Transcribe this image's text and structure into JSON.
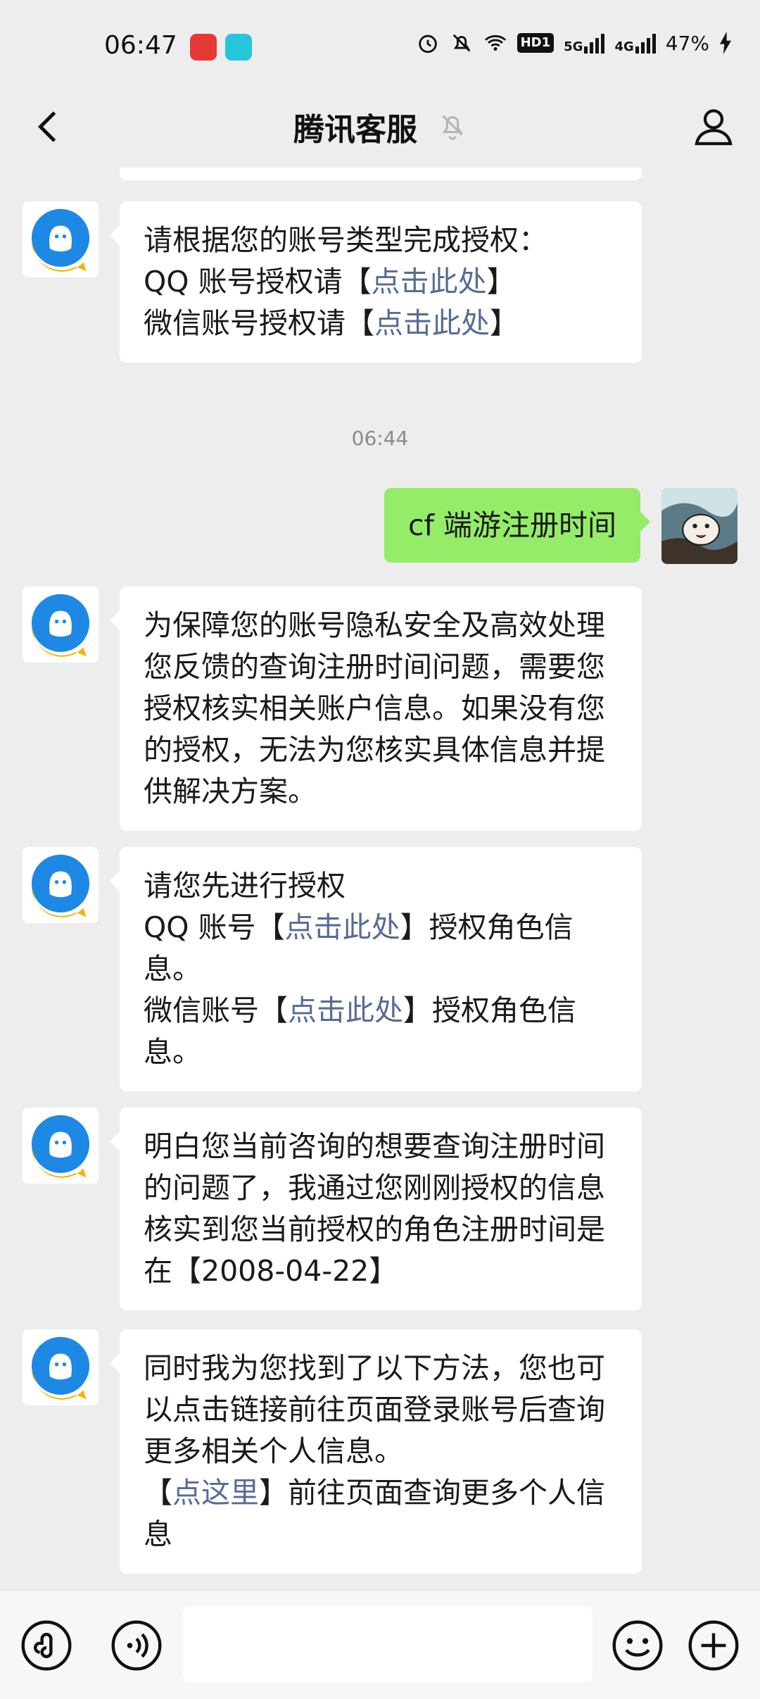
{
  "status_bar": {
    "time": "06:47",
    "network_1": "5G",
    "network_2": "4G",
    "hd_badge": "HD1",
    "battery": "47%"
  },
  "nav": {
    "title": "腾讯客服"
  },
  "messages": [
    {
      "side": "left",
      "parts": [
        {
          "t": "请根据您的账号类型完成授权：\nQQ 账号授权请【"
        },
        {
          "t": "点击此处",
          "link": true
        },
        {
          "t": "】\n微信账号授权请【"
        },
        {
          "t": "点击此处",
          "link": true
        },
        {
          "t": "】"
        }
      ]
    },
    {
      "timestamp": "06:44"
    },
    {
      "side": "right",
      "text": "cf 端游注册时间"
    },
    {
      "side": "left",
      "parts": [
        {
          "t": "为保障您的账号隐私安全及高效处理您反馈的查询注册时间问题，需要您授权核实相关账户信息。如果没有您的授权，无法为您核实具体信息并提供解决方案。"
        }
      ]
    },
    {
      "side": "left",
      "parts": [
        {
          "t": "请您先进行授权\nQQ 账号【"
        },
        {
          "t": "点击此处",
          "link": true
        },
        {
          "t": "】授权角色信息。\n微信账号【"
        },
        {
          "t": "点击此处",
          "link": true
        },
        {
          "t": "】授权角色信息。"
        }
      ]
    },
    {
      "side": "left",
      "parts": [
        {
          "t": "明白您当前咨询的想要查询注册时间的问题了，我通过您刚刚授权的信息核实到您当前授权的角色注册时间是在【2008-04-22】"
        }
      ]
    },
    {
      "side": "left",
      "parts": [
        {
          "t": "同时我为您找到了以下方法，您也可以点击链接前往页面登录账号后查询更多相关个人信息。\n【"
        },
        {
          "t": "点这里",
          "link": true
        },
        {
          "t": "】前往页面查询更多个人信息"
        }
      ]
    }
  ],
  "colors": {
    "background": "#ededed",
    "outgoing_bubble": "#95ec69",
    "link": "#576b95",
    "avatar_blue": "#1e88e5",
    "avatar_yellow": "#f5b400"
  },
  "icons": {
    "back": "chevron-left-icon",
    "mute": "bell-muted-icon",
    "profile": "person-icon",
    "mini_program": "mini-program-icon",
    "voice": "voice-icon",
    "emoji": "emoji-icon",
    "more": "plus-icon"
  }
}
